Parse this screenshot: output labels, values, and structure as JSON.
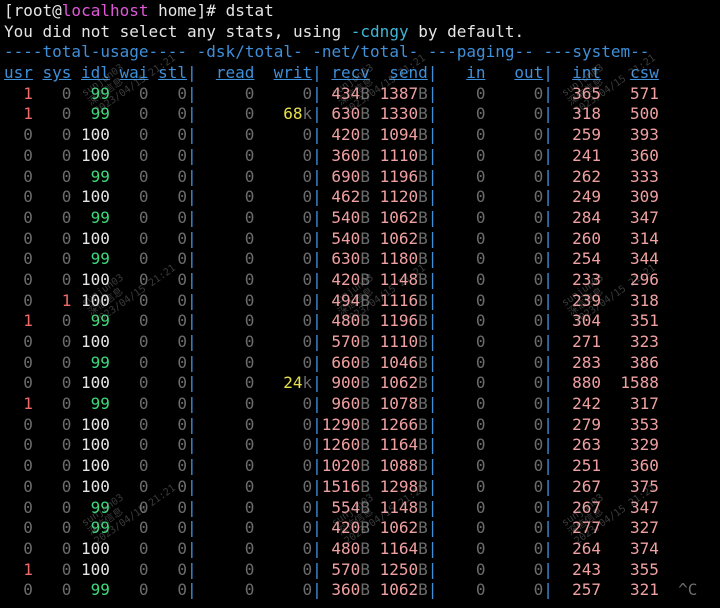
{
  "terminal": {
    "prompt_user_host_prefix": "[root@",
    "prompt_host": "localhost",
    "prompt_suffix": " home]# ",
    "command": "dstat",
    "notice_prefix": "You did not select any stats, using ",
    "notice_flags": "-cdngy",
    "notice_suffix": " by default.",
    "group_header": "----total-usage---- -dsk/total- -net/total- ---paging-- ---system--",
    "columns": [
      "usr",
      "sys",
      "idl",
      "wai",
      "stl",
      "read",
      "writ",
      "recv",
      "send",
      "in",
      "out",
      "int",
      "csw"
    ],
    "rows": [
      [
        "1",
        "0",
        "99",
        "0",
        "0",
        "0",
        "0",
        "434B",
        "1387B",
        "0",
        "0",
        "365",
        "571"
      ],
      [
        "1",
        "0",
        "99",
        "0",
        "0",
        "0",
        "68k",
        "630B",
        "1330B",
        "0",
        "0",
        "318",
        "500"
      ],
      [
        "0",
        "0",
        "100",
        "0",
        "0",
        "0",
        "0",
        "420B",
        "1094B",
        "0",
        "0",
        "259",
        "393"
      ],
      [
        "0",
        "0",
        "100",
        "0",
        "0",
        "0",
        "0",
        "360B",
        "1110B",
        "0",
        "0",
        "241",
        "360"
      ],
      [
        "0",
        "0",
        "99",
        "0",
        "0",
        "0",
        "0",
        "690B",
        "1196B",
        "0",
        "0",
        "262",
        "333"
      ],
      [
        "0",
        "0",
        "100",
        "0",
        "0",
        "0",
        "0",
        "462B",
        "1120B",
        "0",
        "0",
        "249",
        "309"
      ],
      [
        "0",
        "0",
        "99",
        "0",
        "0",
        "0",
        "0",
        "540B",
        "1062B",
        "0",
        "0",
        "284",
        "347"
      ],
      [
        "0",
        "0",
        "100",
        "0",
        "0",
        "0",
        "0",
        "540B",
        "1062B",
        "0",
        "0",
        "260",
        "314"
      ],
      [
        "0",
        "0",
        "99",
        "0",
        "0",
        "0",
        "0",
        "630B",
        "1180B",
        "0",
        "0",
        "254",
        "344"
      ],
      [
        "0",
        "0",
        "100",
        "0",
        "0",
        "0",
        "0",
        "420B",
        "1148B",
        "0",
        "0",
        "233",
        "296"
      ],
      [
        "0",
        "1",
        "100",
        "0",
        "0",
        "0",
        "0",
        "494B",
        "1116B",
        "0",
        "0",
        "239",
        "318"
      ],
      [
        "1",
        "0",
        "99",
        "0",
        "0",
        "0",
        "0",
        "480B",
        "1196B",
        "0",
        "0",
        "304",
        "351"
      ],
      [
        "0",
        "0",
        "100",
        "0",
        "0",
        "0",
        "0",
        "570B",
        "1110B",
        "0",
        "0",
        "271",
        "323"
      ],
      [
        "0",
        "0",
        "99",
        "0",
        "0",
        "0",
        "0",
        "660B",
        "1046B",
        "0",
        "0",
        "283",
        "386"
      ],
      [
        "0",
        "0",
        "100",
        "0",
        "0",
        "0",
        "24k",
        "900B",
        "1062B",
        "0",
        "0",
        "880",
        "1588"
      ],
      [
        "1",
        "0",
        "99",
        "0",
        "0",
        "0",
        "0",
        "960B",
        "1078B",
        "0",
        "0",
        "242",
        "317"
      ],
      [
        "0",
        "0",
        "100",
        "0",
        "0",
        "0",
        "0",
        "1290B",
        "1266B",
        "0",
        "0",
        "279",
        "353"
      ],
      [
        "0",
        "0",
        "100",
        "0",
        "0",
        "0",
        "0",
        "1260B",
        "1164B",
        "0",
        "0",
        "263",
        "329"
      ],
      [
        "0",
        "0",
        "100",
        "0",
        "0",
        "0",
        "0",
        "1020B",
        "1088B",
        "0",
        "0",
        "251",
        "360"
      ],
      [
        "0",
        "0",
        "100",
        "0",
        "0",
        "0",
        "0",
        "1516B",
        "1298B",
        "0",
        "0",
        "267",
        "375"
      ],
      [
        "0",
        "0",
        "99",
        "0",
        "0",
        "0",
        "0",
        "554B",
        "1148B",
        "0",
        "0",
        "267",
        "347"
      ],
      [
        "0",
        "0",
        "99",
        "0",
        "0",
        "0",
        "0",
        "420B",
        "1062B",
        "0",
        "0",
        "277",
        "327"
      ],
      [
        "0",
        "0",
        "100",
        "0",
        "0",
        "0",
        "0",
        "480B",
        "1164B",
        "0",
        "0",
        "264",
        "374"
      ],
      [
        "1",
        "0",
        "100",
        "0",
        "0",
        "0",
        "0",
        "570B",
        "1250B",
        "0",
        "0",
        "243",
        "355"
      ],
      [
        "0",
        "0",
        "99",
        "0",
        "0",
        "0",
        "0",
        "360B",
        "1062B",
        "0",
        "0",
        "257",
        "321"
      ]
    ],
    "interrupt": "^C",
    "colors": {
      "background": "#000000",
      "header_blue": "#3f8fd9",
      "hostname_magenta": "#e057d9",
      "flags_cyan": "#3fb6d6",
      "idle_green": "#3fd97a",
      "value_red": "#f06a6a",
      "zero_gray": "#6c6c6c",
      "disk_yellow": "#e6e04a",
      "net_pink": "#f0a0a0"
    }
  },
  "watermark": {
    "line1": "sunjun03",
    "line2": "深信信息",
    "line3": "2023/04/15 21:21"
  }
}
